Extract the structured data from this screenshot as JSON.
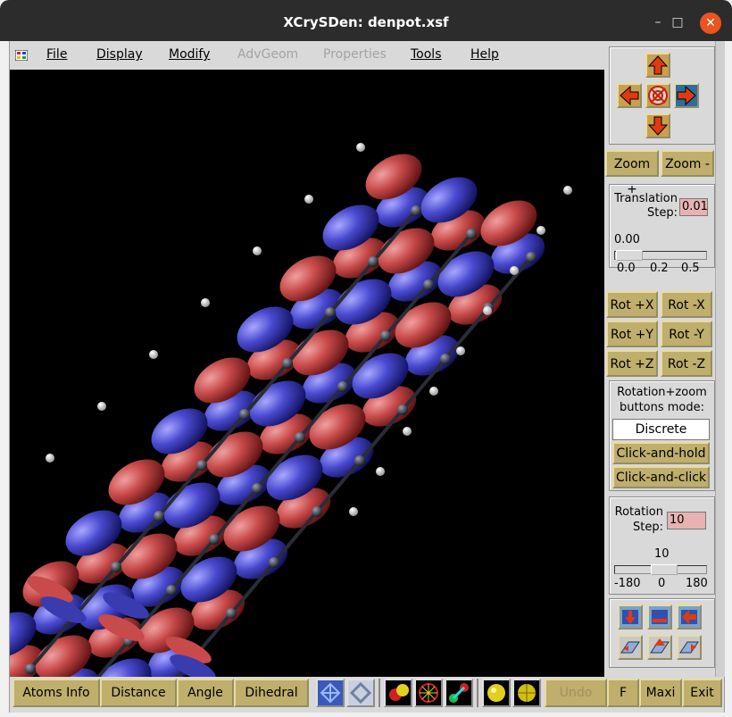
{
  "window": {
    "title": "XCrySDen: denpot.xsf"
  },
  "menu": [
    {
      "label": "File",
      "enabled": true
    },
    {
      "label": "Display",
      "enabled": true
    },
    {
      "label": "Modify",
      "enabled": true
    },
    {
      "label": "AdvGeom",
      "enabled": false
    },
    {
      "label": "Properties",
      "enabled": false
    },
    {
      "label": "Tools",
      "enabled": true
    },
    {
      "label": "Help",
      "enabled": true
    }
  ],
  "side": {
    "zoom_in": "Zoom +",
    "zoom_out": "Zoom -",
    "translation_label": "Translation\nStep:",
    "translation_value": "0.01",
    "translation_slider_value": "0.00",
    "translation_ticks": [
      "0.0",
      "0.2",
      "0.5"
    ],
    "rot": [
      "Rot +X",
      "Rot -X",
      "Rot +Y",
      "Rot -Y",
      "Rot +Z",
      "Rot -Z"
    ],
    "mode_label": "Rotation+zoom\nbuttons mode:",
    "mode_discrete": "Discrete",
    "mode_hold": "Click-and-hold",
    "mode_click": "Click-and-click",
    "rotation_label": "Rotation\nStep:",
    "rotation_value": "10",
    "rotation_slider_value": "10",
    "rotation_ticks": [
      "-180",
      "0",
      "180"
    ]
  },
  "bottom": {
    "atoms_info": "Atoms Info",
    "distance": "Distance",
    "angle": "Angle",
    "dihedral": "Dihedral",
    "undo": "Undo",
    "f": "F",
    "maxi": "Maxi",
    "exit": "Exit"
  },
  "colors": {
    "accent": "#bfae6c",
    "isosurface_positive": "#c84a4a",
    "isosurface_negative": "#4a4ad0",
    "entry_bg": "#e7b2b2"
  }
}
